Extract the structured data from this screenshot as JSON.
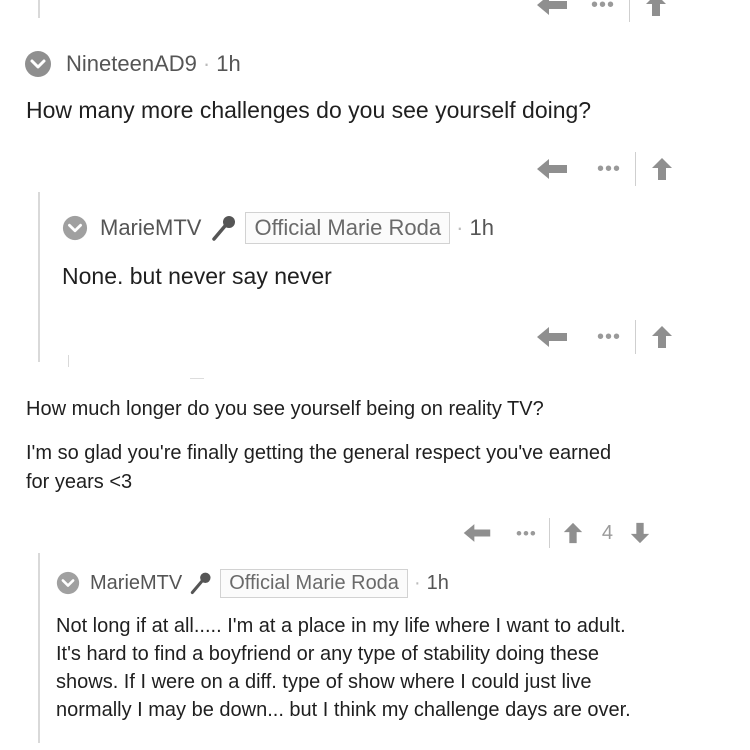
{
  "comments": [
    {
      "username": "NineteenAD9",
      "time": "1h",
      "text": "How many more challenges do you see yourself doing?"
    },
    {
      "username": "MarieMTV",
      "flair": "Official Marie Roda",
      "time": "1h",
      "text": "None. but never say never"
    },
    {
      "text_lines": [
        "How much longer do you see yourself being on reality TV?",
        "I'm so glad you're finally getting the general respect you've earned",
        "for years <3"
      ],
      "score": "4"
    },
    {
      "username": "MarieMTV",
      "flair": "Official Marie Roda",
      "time": "1h",
      "text_lines": [
        "Not long if at all..... I'm at a place in my life where I want to adult.",
        "It's hard to find a boyfriend or any type of stability doing these",
        "shows. If I were on a diff. type of show where I could just live",
        "normally I may be down... but I think my challenge days are over."
      ]
    }
  ],
  "icons": {
    "collapse": "chevron-down-circle-icon",
    "mod_badge": "microphone-icon",
    "reply": "reply-arrow-icon",
    "more": "more-dots-icon",
    "upvote": "upvote-arrow-icon",
    "downvote": "downvote-arrow-icon"
  },
  "colors": {
    "icon_gray": "#8f8f8f",
    "text": "#1f1f1f",
    "meta": "#555555"
  }
}
